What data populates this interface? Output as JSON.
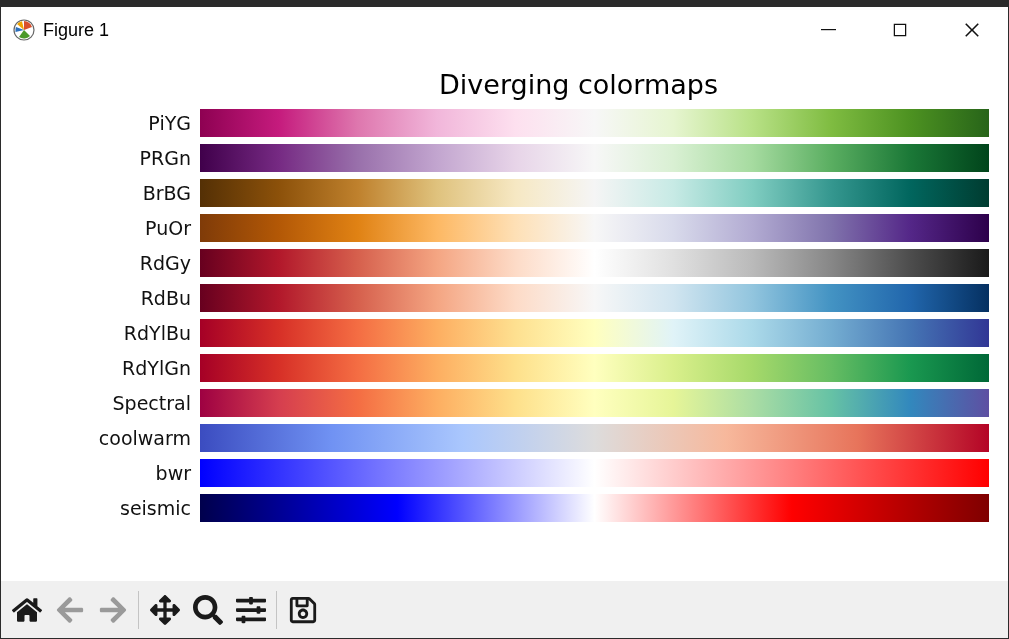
{
  "window": {
    "title": "Figure 1"
  },
  "figure": {
    "title": "Diverging colormaps"
  },
  "colormaps": [
    {
      "name": "PiYG"
    },
    {
      "name": "PRGn"
    },
    {
      "name": "BrBG"
    },
    {
      "name": "PuOr"
    },
    {
      "name": "RdGy"
    },
    {
      "name": "RdBu"
    },
    {
      "name": "RdYlBu"
    },
    {
      "name": "RdYlGn"
    },
    {
      "name": "Spectral"
    },
    {
      "name": "coolwarm"
    },
    {
      "name": "bwr"
    },
    {
      "name": "seismic"
    }
  ],
  "toolbar": [
    {
      "kind": "home",
      "disabled": false
    },
    {
      "kind": "back",
      "disabled": true
    },
    {
      "kind": "forward",
      "disabled": true
    },
    {
      "kind": "separator"
    },
    {
      "kind": "pan",
      "disabled": false
    },
    {
      "kind": "zoom",
      "disabled": false
    },
    {
      "kind": "configure",
      "disabled": false
    },
    {
      "kind": "separator"
    },
    {
      "kind": "save",
      "disabled": false
    }
  ]
}
